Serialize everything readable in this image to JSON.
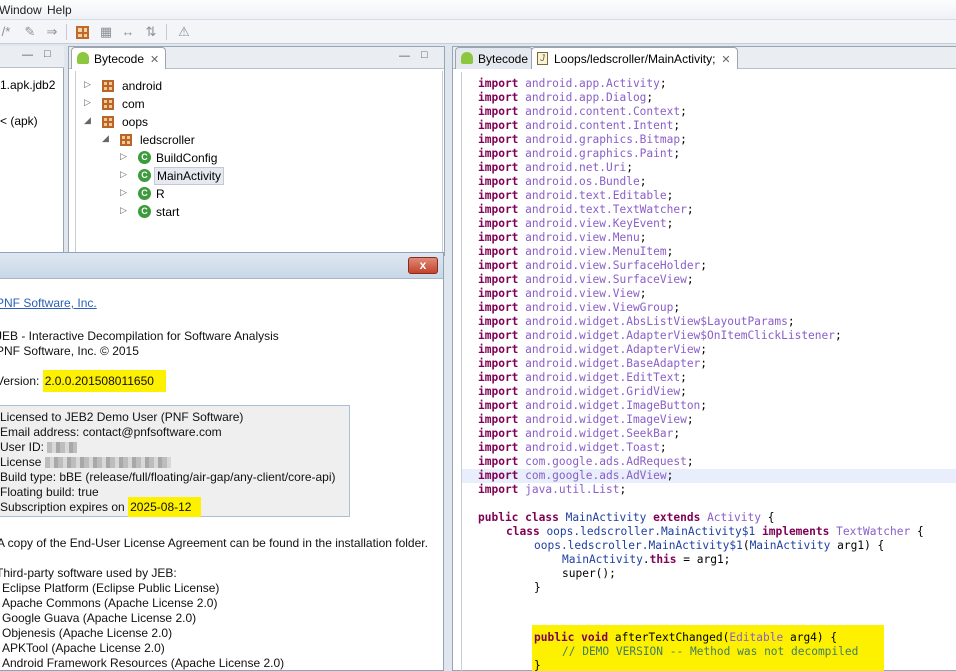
{
  "menubar": {
    "items": [
      "Window",
      "Help"
    ]
  },
  "toolbar": {
    "icons": [
      "edit-icon",
      "pencil-icon",
      "import-icon",
      "package-grid-icon",
      "grid-icon",
      "navigate-icon",
      "hierarchy-icon",
      "warning-icon"
    ]
  },
  "project_view": {
    "lines": [
      "1.apk.jdb2",
      "< (apk)"
    ]
  },
  "tree_view": {
    "tab_label": "Bytecode",
    "nodes": [
      {
        "label": "android",
        "kind": "package",
        "expanded": false
      },
      {
        "label": "com",
        "kind": "package",
        "expanded": false
      },
      {
        "label": "oops",
        "kind": "package",
        "expanded": true
      },
      {
        "label": "ledscroller",
        "kind": "package",
        "expanded": true
      },
      {
        "label": "BuildConfig",
        "kind": "class"
      },
      {
        "label": "MainActivity",
        "kind": "class",
        "selected": true
      },
      {
        "label": "R",
        "kind": "class"
      },
      {
        "label": "start",
        "kind": "class"
      }
    ]
  },
  "dialog": {
    "close_label": "x",
    "company_link": "PNF Software, Inc.",
    "product_line": "JEB - Interactive Decompilation for Software Analysis",
    "copyright_line": "PNF Software, Inc. © 2015",
    "version_label": "Version: ",
    "version_value": "2.0.0.201508011650",
    "license": {
      "licensed_to": "Licensed to JEB2 Demo User (PNF Software)",
      "email": "Email address: contact@pnfsoftware.com",
      "user_id_label": "User ID: ",
      "license_label": "License ",
      "build_type": "Build type: bBE (release/full/floating/air-gap/any-client/core-api)",
      "floating": "Floating build: true",
      "subscription_label": "Subscription expires on ",
      "subscription_date": "2025-08-12"
    },
    "eula_line": "A copy of the End-User License Agreement can be found in the installation folder.",
    "third_party_header": "Third-party software used by JEB:",
    "third_party": [
      "Eclipse Platform (Eclipse Public License)",
      "Apache Commons (Apache License 2.0)",
      "Google Guava (Apache License 2.0)",
      "Objenesis (Apache License 2.0)",
      "APKTool (Apache License 2.0)",
      "Android Framework Resources (Apache License 2.0)"
    ]
  },
  "editor": {
    "tab_bytecode": "Bytecode",
    "tab_source": "Loops/ledscroller/MainActivity;",
    "imports": [
      "android.app.Activity",
      "android.app.Dialog",
      "android.content.Context",
      "android.content.Intent",
      "android.graphics.Bitmap",
      "android.graphics.Paint",
      "android.net.Uri",
      "android.os.Bundle",
      "android.text.Editable",
      "android.text.TextWatcher",
      "android.view.KeyEvent",
      "android.view.Menu",
      "android.view.MenuItem",
      "android.view.SurfaceHolder",
      "android.view.SurfaceView",
      "android.view.View",
      "android.view.ViewGroup",
      "android.widget.AbsListView$LayoutParams",
      "android.widget.AdapterView$OnItemClickListener",
      "android.widget.AdapterView",
      "android.widget.BaseAdapter",
      "android.widget.EditText",
      "android.widget.GridView",
      "android.widget.ImageButton",
      "android.widget.ImageView",
      "android.widget.SeekBar",
      "android.widget.Toast",
      "com.google.ads.AdRequest",
      "com.google.ads.AdView",
      "java.util.List"
    ],
    "import_keyword": "import",
    "class_decl": {
      "kw1": "public class",
      "name": "MainActivity",
      "kw2": "extends",
      "super": "Activity",
      "brace": " {"
    },
    "inner_decl": {
      "kw1": "class",
      "name": "oops.ledscroller.MainActivity$1",
      "kw2": "implements",
      "iface": "TextWatcher",
      "brace": " {"
    },
    "ctor_line": {
      "name": "oops.ledscroller.MainActivity$1",
      "rest_open": "(",
      "ptype": "MainActivity",
      "rest_close": " arg1) {"
    },
    "assign_line": {
      "target": "MainActivity",
      "kw": "this",
      "rest": " = arg1;"
    },
    "super_line": "super();",
    "close_brace": "}",
    "method_decl": {
      "kw": "public void",
      "name": " afterTextChanged(",
      "ptype": "Editable",
      "rest": " arg4) {"
    },
    "method_comment": "// DEMO VERSION -- Method was not decompiled",
    "method_close": "}"
  }
}
